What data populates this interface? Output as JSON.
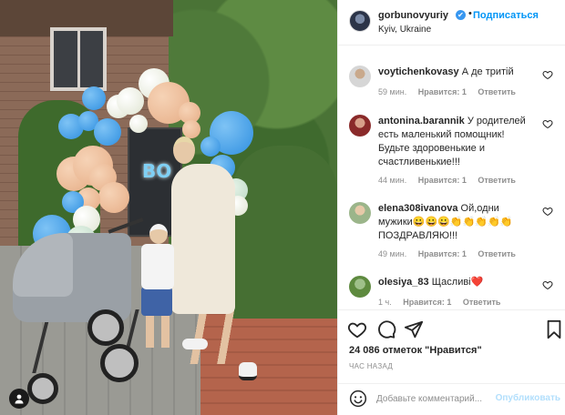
{
  "header": {
    "username": "gorbunovyuriy",
    "verified_mark": "✔",
    "separator": "•",
    "follow_label": "Подписаться",
    "location": "Kyiv, Ukraine"
  },
  "photo": {
    "sign_text": "BO"
  },
  "comments": [
    {
      "username": "voytichenkovasy",
      "text": "А де тритій",
      "time": "59 мин.",
      "likes": "Нравится: 1",
      "reply": "Ответить"
    },
    {
      "username": "antonina.barannik",
      "text": "У родителей есть маленький помощник! Будьте здоровенькие и счастливенькие!!!",
      "time": "44 мин.",
      "likes": "Нравится: 1",
      "reply": "Ответить"
    },
    {
      "username": "elena308ivanova",
      "text": "Ой,одни мужики😀😀😀👏👏👏👏👏 ПОЗДРАВЛЯЮ!!!",
      "time": "49 мин.",
      "likes": "Нравится: 1",
      "reply": "Ответить"
    },
    {
      "username": "olesiya_83",
      "text": "Щасливі❤️",
      "time": "1 ч.",
      "likes": "Нравится: 1",
      "reply": "Ответить"
    }
  ],
  "actions": {
    "likes_count": "24 086 отметок \"Нравится\"",
    "time_ago": "ЧАС НАЗАД",
    "comment_placeholder": "Добавьте комментарий...",
    "post_label": "Опубликовать"
  },
  "icons": [
    "user-icon",
    "verified-icon",
    "heart-icon",
    "comment-icon",
    "share-icon",
    "bookmark-icon",
    "emoji-icon"
  ],
  "colors": {
    "link_blue": "#0095f6",
    "post_disabled": "#b2dffc",
    "muted": "#8e8e8e"
  }
}
